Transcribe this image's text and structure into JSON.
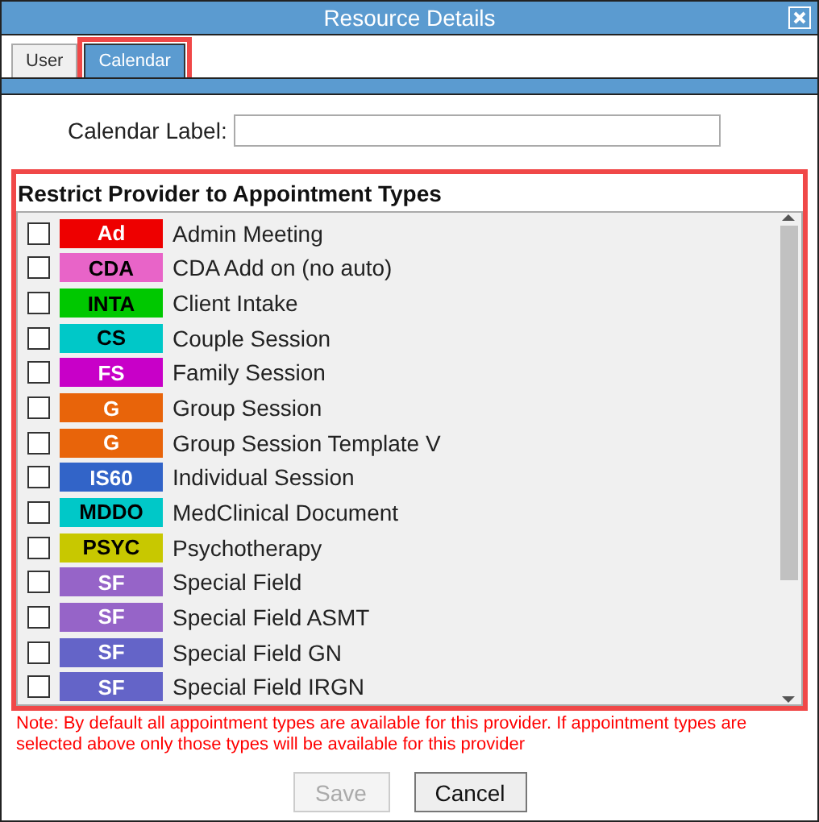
{
  "window": {
    "title": "Resource Details"
  },
  "tabs": [
    {
      "label": "User",
      "selected": false,
      "highlighted": false
    },
    {
      "label": "Calendar",
      "selected": true,
      "highlighted": true
    }
  ],
  "calendar_label": {
    "label": "Calendar Label:"
  },
  "section": {
    "title": "Restrict Provider to Appointment Types",
    "highlighted": true
  },
  "appointment_types": [
    {
      "code": "Ad",
      "name": "Admin Meeting",
      "color": "#ee0000",
      "dark_code": false,
      "checked": false
    },
    {
      "code": "CDA",
      "name": "CDA Add on (no auto)",
      "color": "#e864c8",
      "dark_code": true,
      "checked": false
    },
    {
      "code": "INTA",
      "name": "Client Intake",
      "color": "#00c800",
      "dark_code": true,
      "checked": false
    },
    {
      "code": "CS",
      "name": "Couple Session",
      "color": "#00c8c8",
      "dark_code": true,
      "checked": false
    },
    {
      "code": "FS",
      "name": "Family Session",
      "color": "#c800c8",
      "dark_code": false,
      "checked": false
    },
    {
      "code": "G",
      "name": "Group Session",
      "color": "#e8640a",
      "dark_code": false,
      "checked": false
    },
    {
      "code": "G",
      "name": "Group Session Template V",
      "color": "#e8640a",
      "dark_code": false,
      "checked": false
    },
    {
      "code": "IS60",
      "name": "Individual Session",
      "color": "#3264c8",
      "dark_code": false,
      "checked": false
    },
    {
      "code": "MDDO",
      "name": "MedClinical Document",
      "color": "#00c8c8",
      "dark_code": true,
      "checked": false
    },
    {
      "code": "PSYC",
      "name": "Psychotherapy",
      "color": "#c8c800",
      "dark_code": true,
      "checked": false
    },
    {
      "code": "SF",
      "name": "Special Field",
      "color": "#9664c8",
      "dark_code": false,
      "checked": false
    },
    {
      "code": "SF",
      "name": "Special Field ASMT",
      "color": "#9664c8",
      "dark_code": false,
      "checked": false
    },
    {
      "code": "SF",
      "name": "Special Field GN",
      "color": "#6464c8",
      "dark_code": false,
      "checked": false
    },
    {
      "code": "SF",
      "name": "Special Field IRGN",
      "color": "#6464c8",
      "dark_code": false,
      "checked": false
    }
  ],
  "note": "Note: By default all appointment types are available for this provider. If appointment types are selected above only those types will be available for this provider",
  "buttons": [
    {
      "label": "Save",
      "disabled": true
    },
    {
      "label": "Cancel",
      "disabled": false
    }
  ]
}
